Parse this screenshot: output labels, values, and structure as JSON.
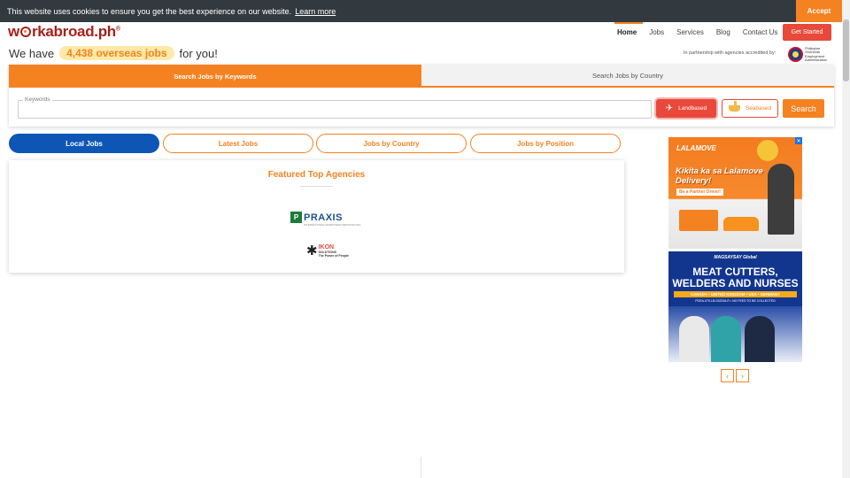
{
  "cookie": {
    "message": "This website uses cookies to ensure you get the best experience on our website.",
    "learn_more": "Learn more",
    "accept": "Accept"
  },
  "brand": {
    "logo_pre": "w",
    "logo_post": "rkabroad.ph",
    "logo_reg": "®"
  },
  "nav": {
    "items": [
      "Home",
      "Jobs",
      "Services",
      "Blog",
      "Contact Us"
    ],
    "active": "Home",
    "cta": "Get Started"
  },
  "headline": {
    "pre": "We have",
    "highlight": "4,438 overseas jobs",
    "post": "for you!"
  },
  "partner": {
    "text": "In partnership with agencies accredited by:",
    "agency": "Philippine Overseas Employment Administration"
  },
  "search": {
    "tab_keywords": "Search Jobs by Keywords",
    "tab_country": "Search Jobs by Country",
    "keywords_label": "Keywords",
    "landbased": "Landbased",
    "seabased": "Seabased",
    "search_button": "Search"
  },
  "categories": [
    "Local Jobs",
    "Latest Jobs",
    "Jobs by Country",
    "Jobs by Position"
  ],
  "featured": {
    "title": "Featured Top Agencies",
    "agencies": [
      {
        "name": "PRAXIS",
        "tagline": "INTERNATIONAL MANPOWER SERVICES INC."
      },
      {
        "name": "IKON",
        "sub": "SOLUTIONS",
        "tagline": "The Power of People"
      }
    ]
  },
  "ads": {
    "ad1": {
      "brand": "LALAMOVE",
      "headline": "Kikita ka sa Lalamove Delivery!",
      "sub": "Be a Partner Driver!"
    },
    "ad2": {
      "brand": "MAGSAYSAY Global",
      "headline": "MEAT CUTTERS, WELDERS AND NURSES",
      "countries": "CANADA • UNITED KINGDOM • USA • GERMANY",
      "license": "POEA-070-LB-032316-R • NO FEES TO BE COLLECTED"
    }
  },
  "colors": {
    "orange": "#f58220",
    "red": "#e8493a",
    "blue": "#0d56b5",
    "dark": "#333a3f"
  }
}
